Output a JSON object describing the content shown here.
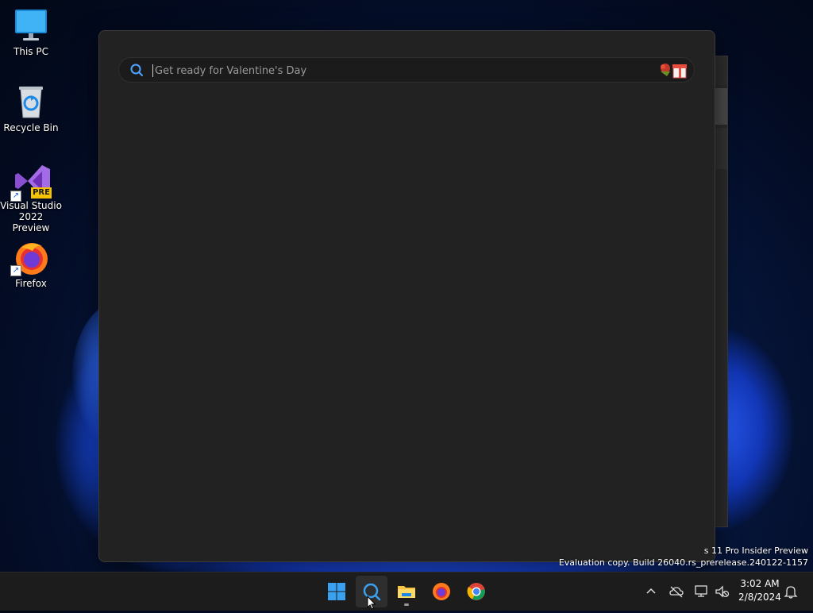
{
  "desktop": {
    "icons": [
      {
        "label": "This PC",
        "icon": "monitor-icon"
      },
      {
        "label": "Recycle Bin",
        "icon": "recycle-bin-icon"
      },
      {
        "label": "Visual Studio 2022 Preview",
        "icon": "visual-studio-preview-icon",
        "badge": "PRE"
      },
      {
        "label": "Firefox",
        "icon": "firefox-icon"
      }
    ]
  },
  "search": {
    "placeholder": "Get ready for Valentine's Day",
    "highlight_icon": "valentine-gift-icon",
    "search_icon": "search-icon"
  },
  "watermark": {
    "line1": "s 11 Pro Insider Preview",
    "line2": "Evaluation copy. Build 26040.rs_prerelease.240122-1157"
  },
  "taskbar": {
    "apps": [
      {
        "name": "start",
        "icon": "windows-start-icon"
      },
      {
        "name": "search",
        "icon": "search-icon",
        "active": true
      },
      {
        "name": "file-explorer",
        "icon": "folder-icon",
        "running": true
      },
      {
        "name": "firefox",
        "icon": "firefox-icon"
      },
      {
        "name": "chrome",
        "icon": "chrome-icon"
      }
    ],
    "tray": {
      "icons": [
        "chevron-up-icon",
        "onedrive-offline-icon",
        "network-icon",
        "volume-muted-icon"
      ],
      "time": "3:02 AM",
      "date": "2/8/2024",
      "notification_icon": "notification-bell-icon"
    }
  },
  "colors": {
    "accent": "#0078d4",
    "panel_bg": "#222222",
    "taskbar_bg": "#1c1c1c"
  }
}
